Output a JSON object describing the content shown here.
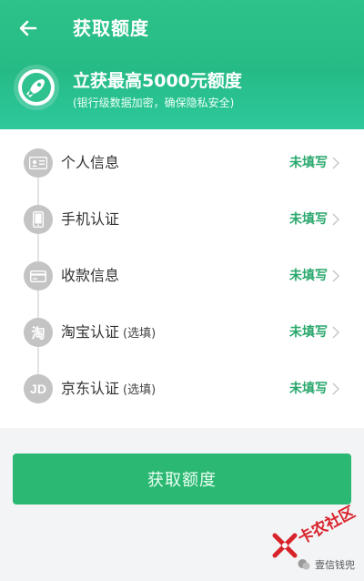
{
  "header": {
    "title": "获取额度",
    "promo_title": "立获最高5000元额度",
    "promo_subtitle": "(银行级数据加密，确保隐私安全)"
  },
  "items": [
    {
      "label": "个人信息",
      "optional": "",
      "status": "未填写",
      "icon": "id-card-icon"
    },
    {
      "label": "手机认证",
      "optional": "",
      "status": "未填写",
      "icon": "phone-icon"
    },
    {
      "label": "收款信息",
      "optional": "",
      "status": "未填写",
      "icon": "bank-card-icon"
    },
    {
      "label": "淘宝认证",
      "optional": "(选填)",
      "status": "未填写",
      "icon": "taobao-icon",
      "icon_text": "淘"
    },
    {
      "label": "京东认证",
      "optional": "(选填)",
      "status": "未填写",
      "icon": "jd-icon",
      "icon_text": "JD"
    }
  ],
  "submit_label": "获取额度",
  "watermark": {
    "brand": "卡农社区",
    "account": "壹信钱兜"
  },
  "colors": {
    "header_green": "#26bb86",
    "status_green": "#2aa86e",
    "button_green": "#2bb872",
    "icon_gray": "#c4c4c4"
  }
}
